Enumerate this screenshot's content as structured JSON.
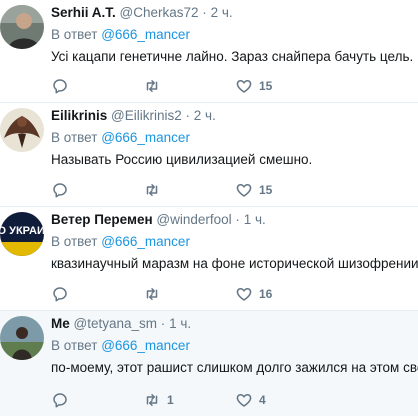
{
  "labels": {
    "reply_prefix": "В ответ"
  },
  "colors": {
    "link": "#1b95e0",
    "muted": "#657786",
    "text": "#14171a",
    "divider": "#e6ecf0"
  },
  "tweets": [
    {
      "name": "Serhii A.T.",
      "handle": "@Cherkas72",
      "dot": "·",
      "time": "2 ч.",
      "reply_to": "@666_mancer",
      "text": "Усі кацапи генетичне лайно. Зараз снайпера бачуть цель.",
      "replies": "",
      "retweets": "",
      "likes": "15"
    },
    {
      "name": "Eilikrinis",
      "handle": "@Eilikrinis2",
      "dot": "·",
      "time": "2 ч.",
      "reply_to": "@666_mancer",
      "text": "Называть Россию цивилизацией смешно.",
      "replies": "",
      "retweets": "",
      "likes": "15"
    },
    {
      "name": "Ветер Перемен",
      "handle": "@winderfool",
      "dot": "·",
      "time": "1 ч.",
      "reply_to": "@666_mancer",
      "text": "квазинаучный маразм на фоне исторической шизофрении",
      "replies": "",
      "retweets": "",
      "likes": "16",
      "avatar_text": "ЭТО УКРАИНА"
    },
    {
      "name": "Me",
      "handle": "@tetyana_sm",
      "dot": "·",
      "time": "1 ч.",
      "reply_to": "@666_mancer",
      "text": "по-моему, этот рашист слишком долго зажился на этом свете",
      "replies": "",
      "retweets": "1",
      "likes": "4"
    }
  ]
}
